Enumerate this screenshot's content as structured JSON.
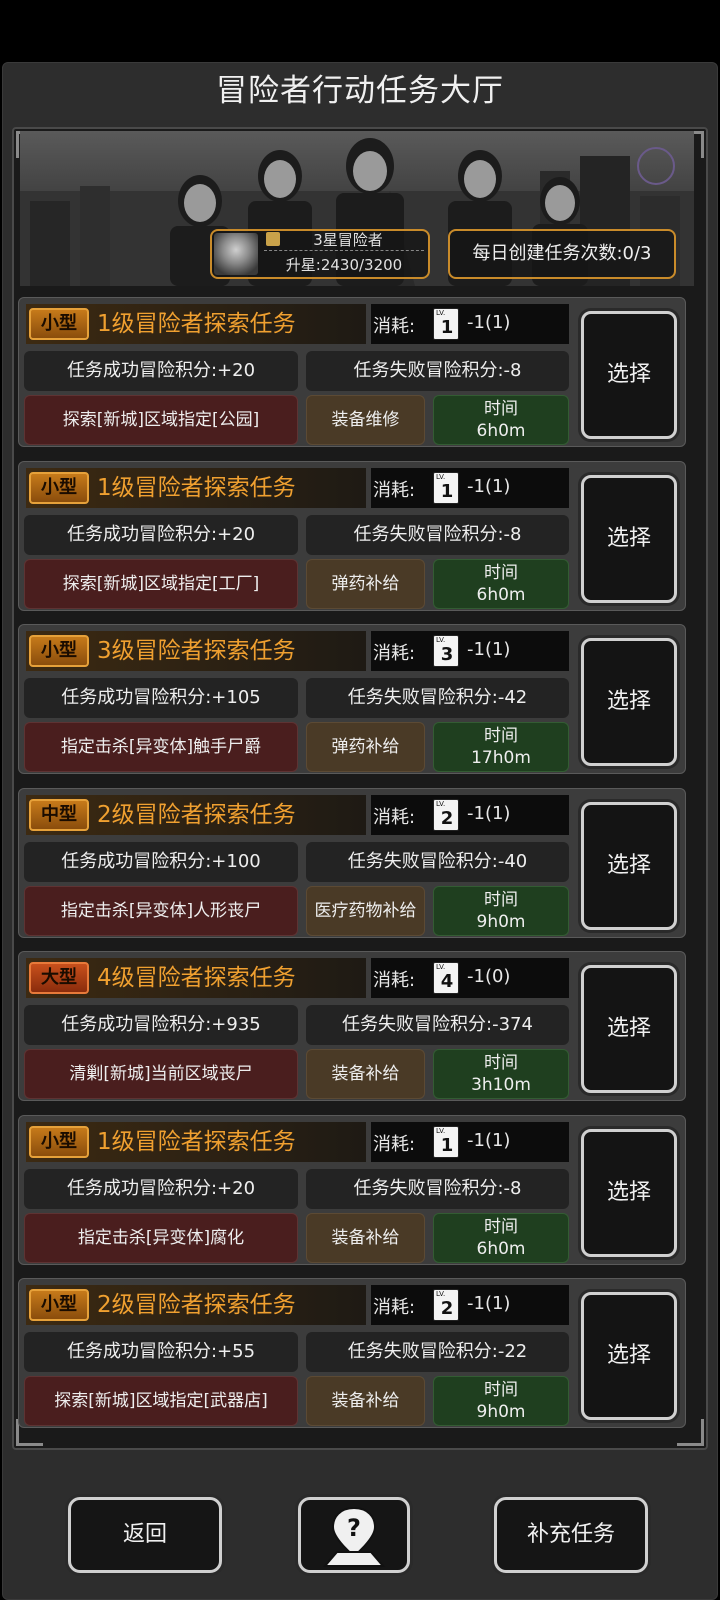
{
  "title": "冒险者行动任务大厅",
  "rank": {
    "name": "3星冒险者",
    "progress": "升星:2430/3200"
  },
  "daily": "每日创建任务次数:0/3",
  "cost_label": "消耗:",
  "lv_label": "LV.",
  "select_label": "选择",
  "time_label": "时间",
  "tasks": [
    {
      "size": "小型",
      "title": "1级冒险者探索任务",
      "lv": "1",
      "cost": "-1(1)",
      "success": "任务成功冒险积分:+20",
      "fail": "任务失败冒险积分:-8",
      "target": "探索[新城]区域指定[公园]",
      "reward": "装备维修",
      "time": "6h0m"
    },
    {
      "size": "小型",
      "title": "1级冒险者探索任务",
      "lv": "1",
      "cost": "-1(1)",
      "success": "任务成功冒险积分:+20",
      "fail": "任务失败冒险积分:-8",
      "target": "探索[新城]区域指定[工厂]",
      "reward": "弹药补给",
      "time": "6h0m"
    },
    {
      "size": "小型",
      "title": "3级冒险者探索任务",
      "lv": "3",
      "cost": "-1(1)",
      "success": "任务成功冒险积分:+105",
      "fail": "任务失败冒险积分:-42",
      "target": "指定击杀[异变体]触手尸爵",
      "reward": "弹药补给",
      "time": "17h0m"
    },
    {
      "size": "中型",
      "title": "2级冒险者探索任务",
      "lv": "2",
      "cost": "-1(1)",
      "success": "任务成功冒险积分:+100",
      "fail": "任务失败冒险积分:-40",
      "target": "指定击杀[异变体]人形丧尸",
      "reward": "医疗药物补给",
      "time": "9h0m"
    },
    {
      "size": "大型",
      "title": "4级冒险者探索任务",
      "lv": "4",
      "cost": "-1(0)",
      "success": "任务成功冒险积分:+935",
      "fail": "任务失败冒险积分:-374",
      "target": "清剿[新城]当前区域丧尸",
      "reward": "装备补给",
      "time": "3h10m"
    },
    {
      "size": "小型",
      "title": "1级冒险者探索任务",
      "lv": "1",
      "cost": "-1(1)",
      "success": "任务成功冒险积分:+20",
      "fail": "任务失败冒险积分:-8",
      "target": "指定击杀[异变体]腐化",
      "reward": "装备补给",
      "time": "6h0m"
    },
    {
      "size": "小型",
      "title": "2级冒险者探索任务",
      "lv": "2",
      "cost": "-1(1)",
      "success": "任务成功冒险积分:+55",
      "fail": "任务失败冒险积分:-22",
      "target": "探索[新城]区域指定[武器店]",
      "reward": "装备补给",
      "time": "9h0m"
    }
  ],
  "footer": {
    "back": "返回",
    "help_icon": "help-map-pin-icon",
    "refill": "补充任务"
  }
}
